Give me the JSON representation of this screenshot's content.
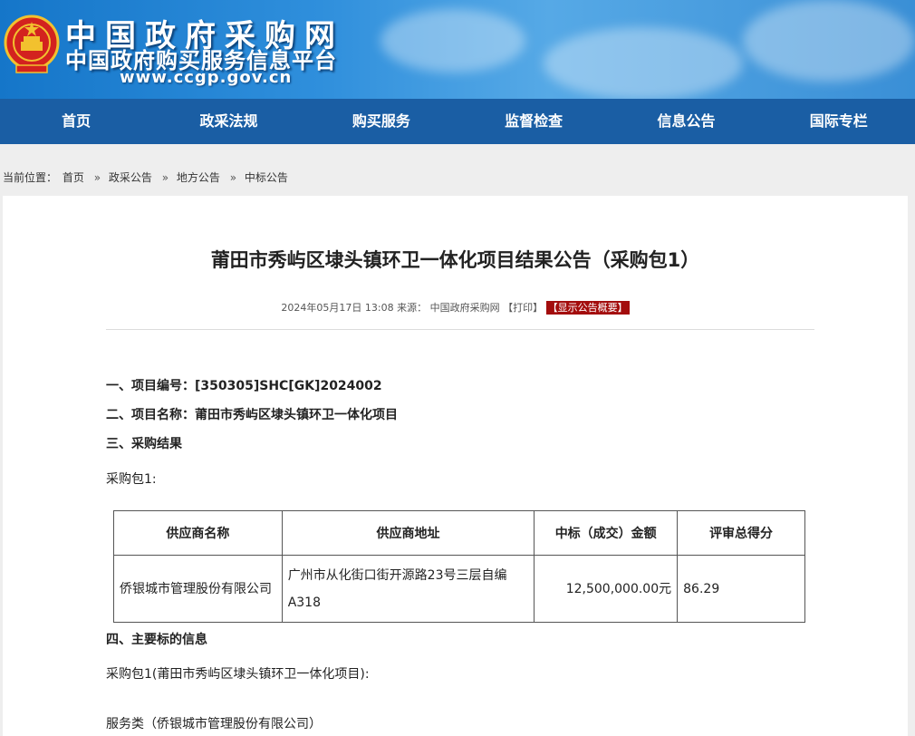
{
  "header": {
    "site_title": "中国政府采购网",
    "site_subtitle": "中国政府购买服务信息平台",
    "site_url": "www.ccgp.gov.cn"
  },
  "nav": {
    "items": [
      "首页",
      "政采法规",
      "购买服务",
      "监督检查",
      "信息公告",
      "国际专栏"
    ]
  },
  "breadcrumb": {
    "label": "当前位置：",
    "items": [
      "首页",
      "政采公告",
      "地方公告",
      "中标公告"
    ],
    "separator": "»"
  },
  "article": {
    "title": "莆田市秀屿区埭头镇环卫一体化项目结果公告（采购包1）",
    "date": "2024年05月17日 13:08",
    "source_label": "来源：",
    "source": "中国政府采购网",
    "print_label": "【打印】",
    "summary_label": "【显示公告概要】",
    "section1": "一、项目编号：[350305]SHC[GK]2024002",
    "section2": "二、项目名称：莆田市秀屿区埭头镇环卫一体化项目",
    "section3": "三、采购结果",
    "package_label": "采购包1:",
    "table": {
      "headers": [
        "供应商名称",
        "供应商地址",
        "中标（成交）金额",
        "评审总得分"
      ],
      "rows": [
        [
          "侨银城市管理股份有限公司",
          "广州市从化街口街开源路23号三层自编A318",
          "12,500,000.00元",
          "86.29"
        ]
      ]
    },
    "section4": "四、主要标的信息",
    "package_detail": "采购包1(莆田市秀屿区埭头镇环卫一体化项目):",
    "service_line": "服务类（侨银城市管理股份有限公司）"
  },
  "colors": {
    "nav_bg": "#1a5ea4",
    "summary_badge": "#a30d0d"
  }
}
